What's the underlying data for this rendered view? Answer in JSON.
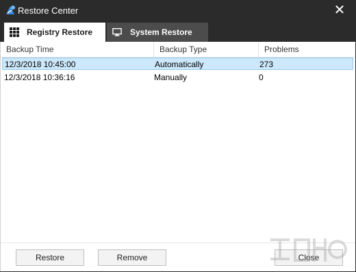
{
  "window": {
    "title": "Restore Center",
    "close_glyph": "✕",
    "icon": "app-logo-icon"
  },
  "tabs": [
    {
      "label": "Registry Restore",
      "icon": "grid-icon",
      "active": true
    },
    {
      "label": "System Restore",
      "icon": "monitor-icon",
      "active": false
    }
  ],
  "table": {
    "columns": [
      "Backup Time",
      "Backup Type",
      "Problems"
    ],
    "rows": [
      {
        "time": "12/3/2018 10:45:00",
        "type": "Automatically",
        "problems": "273",
        "selected": true
      },
      {
        "time": "12/3/2018 10:36:16",
        "type": "Manually",
        "problems": "0",
        "selected": false
      }
    ]
  },
  "buttons": {
    "restore": "Restore",
    "remove": "Remove",
    "close": "Close"
  },
  "colors": {
    "titlebar": "#2b2b2b",
    "tab_inactive": "#4c4c4c",
    "selection": "#cde8fb",
    "selection_border": "#8fcaf2"
  }
}
